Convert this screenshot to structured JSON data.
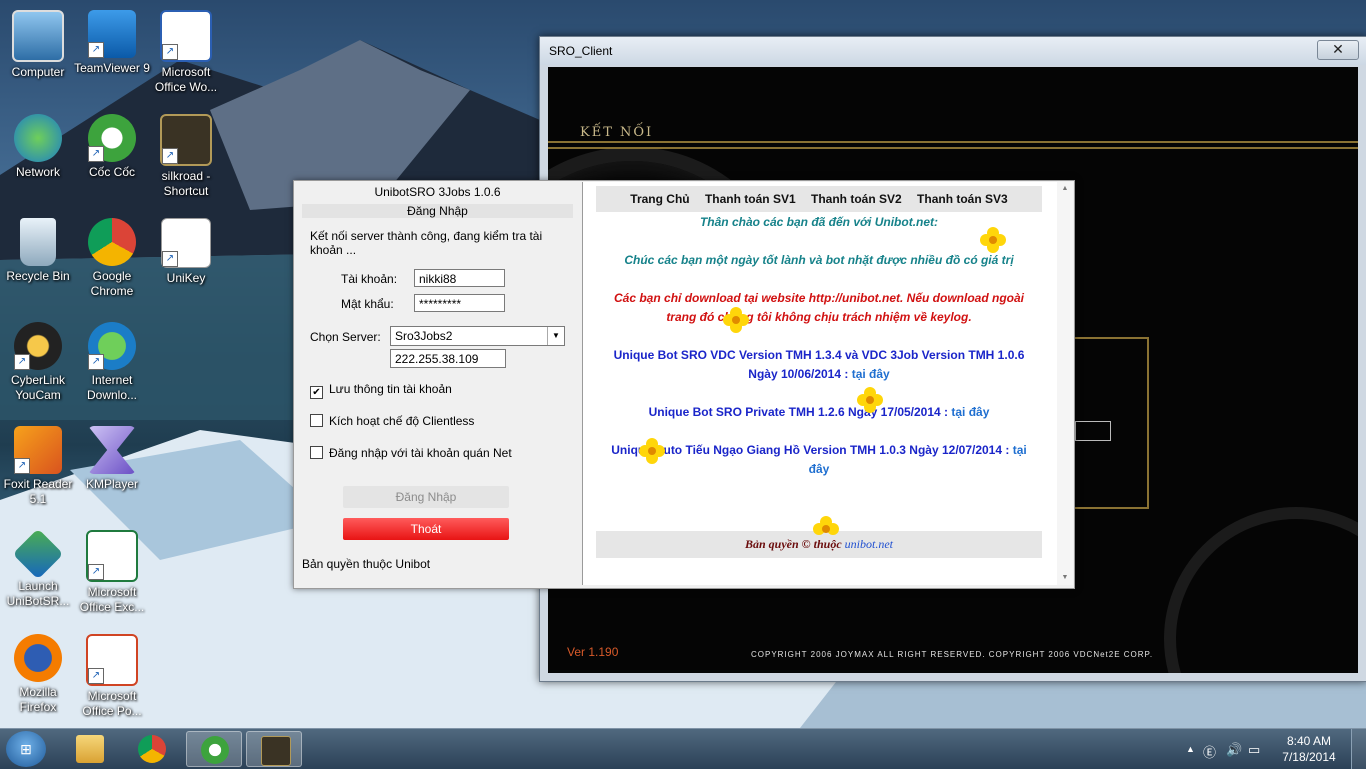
{
  "desktop": {
    "icons": [
      {
        "label": "Computer",
        "icon": "computer-icon"
      },
      {
        "label": "TeamViewer 9",
        "icon": "teamviewer-icon"
      },
      {
        "label": "Microsoft Office Wo...",
        "icon": "word-icon"
      },
      {
        "label": "Network",
        "icon": "network-icon"
      },
      {
        "label": "Cốc Cốc",
        "icon": "coccoc-icon"
      },
      {
        "label": "silkroad - Shortcut",
        "icon": "silkroad-icon"
      },
      {
        "label": "Recycle Bin",
        "icon": "recycle-bin-icon"
      },
      {
        "label": "Google Chrome",
        "icon": "chrome-icon"
      },
      {
        "label": "UniKey",
        "icon": "unikey-icon"
      },
      {
        "label": "CyberLink YouCam",
        "icon": "youcam-icon"
      },
      {
        "label": "Internet Downlo...",
        "icon": "idm-icon"
      },
      {
        "label": "Foxit Reader 5.1",
        "icon": "foxit-icon"
      },
      {
        "label": "KMPlayer",
        "icon": "kmplayer-icon"
      },
      {
        "label": "Launch UniBotSR...",
        "icon": "unibot-icon"
      },
      {
        "label": "Microsoft Office Exc...",
        "icon": "excel-icon"
      },
      {
        "label": "Mozilla Firefox",
        "icon": "firefox-icon"
      },
      {
        "label": "Microsoft Office Po...",
        "icon": "powerpoint-icon"
      }
    ]
  },
  "sro": {
    "title": "SRO_Client",
    "close": "✕",
    "connect_label": "KẾT NỐI",
    "version": "Ver 1.190",
    "copyright": "COPYRIGHT 2006 JOYMAX ALL RIGHT RESERVED. COPYRIGHT 2006 VDCNet2E CORP."
  },
  "unibot": {
    "title": "UnibotSRO 3Jobs 1.0.6",
    "section": "Đăng Nhập",
    "status": "Kết nối server thành công, đang kiểm tra tài khoản ...",
    "account_label": "Tài khoản:",
    "account_value": "nikki88",
    "password_label": "Mật khẩu:",
    "password_value": "*********",
    "server_label": "Chọn Server:",
    "server_value": "Sro3Jobs2",
    "ip_value": "222.255.38.109",
    "checks": [
      {
        "label": "Lưu thông tin tài khoản",
        "checked": true
      },
      {
        "label": "Kích hoạt chế độ Clientless",
        "checked": false
      },
      {
        "label": "Đăng nhập với tài khoản quán Net",
        "checked": false
      }
    ],
    "login_button": "Đăng Nhập",
    "exit_button": "Thoát",
    "copyright": "Bản quyền thuộc Unibot"
  },
  "web": {
    "nav": [
      "Trang Chủ",
      "Thanh toán SV1",
      "Thanh toán SV2",
      "Thanh toán SV3"
    ],
    "greeting": "Thân chào các bạn đã đến với Unibot.net:",
    "wish": "Chúc các bạn một ngày tốt lành và bot nhặt được nhiều đồ có giá trị",
    "warning": "Các bạn chỉ download tại website http://unibot.net. Nếu download ngoài trang đó chúng tôi không chịu trách nhiệm về keylog.",
    "news": [
      {
        "text": "Unique Bot SRO VDC Version TMH 1.3.4 và VDC 3Job Version TMH 1.0.6 Ngày 10/06/2014 :",
        "link": "tại đây"
      },
      {
        "text": "Unique Bot SRO Private TMH 1.2.6 Ngày 17/05/2014 :",
        "link": "tại đây"
      },
      {
        "text": "Unique Auto Tiếu Ngạo Giang Hồ Version TMH 1.0.3 Ngày 12/07/2014 :",
        "link": "tại đây"
      }
    ],
    "footer_text": "Bản quyền © thuộc",
    "footer_link": "unibot.net"
  },
  "taskbar": {
    "time": "8:40 AM",
    "date": "7/18/2014",
    "items": [
      "windows-explorer-icon",
      "chrome-icon",
      "coccoc-icon",
      "silkroad-icon"
    ]
  },
  "colors": {
    "accent_red": "#e81414",
    "greeting_teal": "#16828a",
    "warning_red": "#d11111",
    "news_blue": "#1a25c9"
  }
}
